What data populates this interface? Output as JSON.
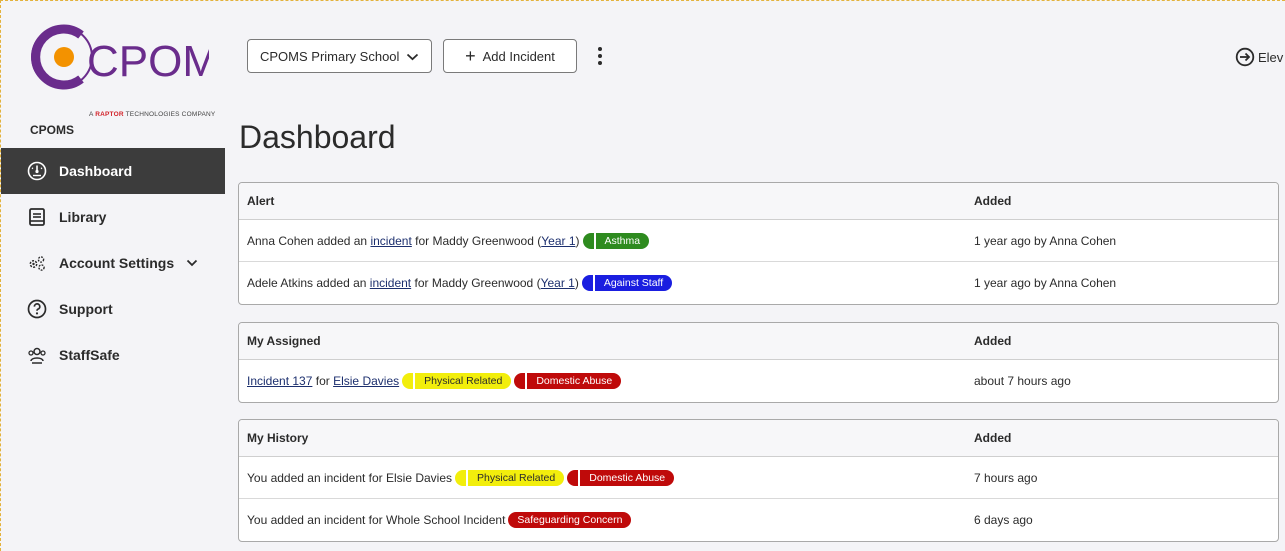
{
  "brand": {
    "logo_text": "CPOMS",
    "logo_tagline_prefix": "A",
    "logo_tagline_brand": "RAPTOR",
    "logo_tagline_suffix": "TECHNOLOGIES COMPANY",
    "colors": {
      "orange": "#f39200",
      "purple": "#6a2c8c",
      "red": "#d2232a"
    }
  },
  "sidebar": {
    "section_label": "CPOMS",
    "items": [
      {
        "label": "Dashboard",
        "icon": "gauge-icon",
        "active": true
      },
      {
        "label": "Library",
        "icon": "book-icon"
      },
      {
        "label": "Account Settings",
        "icon": "gears-icon",
        "has_chevron": true
      },
      {
        "label": "Support",
        "icon": "question-circle-icon"
      },
      {
        "label": "StaffSafe",
        "icon": "users-icon"
      }
    ]
  },
  "toolbar": {
    "school_select_value": "CPOMS Primary School",
    "add_incident_label": "Add Incident",
    "elevate_label": "Elev"
  },
  "page": {
    "title": "Dashboard"
  },
  "alert_panel": {
    "header": "Alert",
    "added_header": "Added",
    "rows": [
      {
        "actor": "Anna Cohen added an",
        "link": "incident",
        "mid": "for Maddy Greenwood",
        "year_link": "Year 1",
        "tag": "Asthma",
        "added": "1 year ago by Anna Cohen"
      },
      {
        "actor": "Adele Atkins added an",
        "link": "incident",
        "mid": "for Maddy Greenwood",
        "year_link": "Year 1",
        "tag": "Against Staff",
        "added": "1 year ago by Anna Cohen"
      }
    ]
  },
  "assigned_panel": {
    "header": "My Assigned",
    "added_header": "Added",
    "rows": [
      {
        "link": "Incident 137",
        "mid": "for",
        "student_link": "Elsie Davies",
        "tags": [
          "Physical Related",
          "Domestic Abuse"
        ],
        "added": "about 7 hours ago"
      }
    ]
  },
  "history_panel": {
    "header": "My History",
    "added_header": "Added",
    "rows": [
      {
        "text": "You added an incident for Elsie Davies",
        "tags": [
          "Physical Related",
          "Domestic Abuse"
        ],
        "added": "7 hours ago"
      },
      {
        "text": "You added an incident for Whole School Incident",
        "tags": [
          "Safeguarding Concern"
        ],
        "added": "6 days ago"
      }
    ]
  },
  "tag_colors": {
    "asthma": "#2e8b1f",
    "against_staff": "#1a1ee0",
    "physical_related": "#f2ee0c",
    "domestic_abuse": "#bf0a0a",
    "safeguarding_concern": "#bf0a0a"
  }
}
